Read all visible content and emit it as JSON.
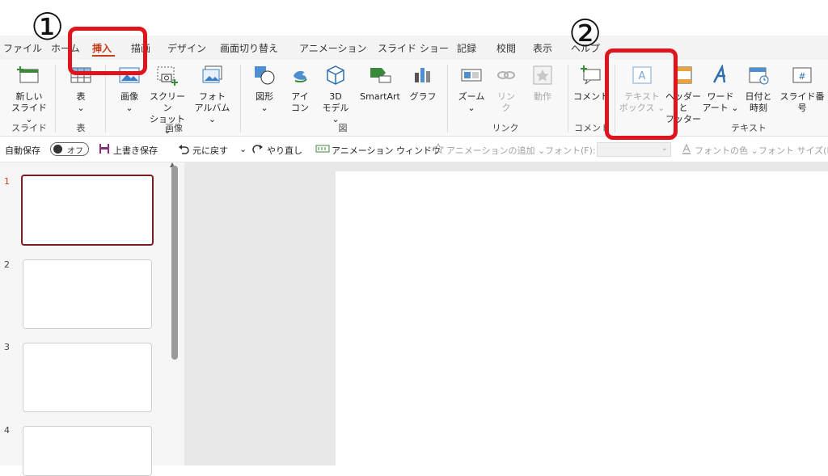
{
  "menu": {
    "tabs": [
      "ファイル",
      "ホーム",
      "挿入",
      "描画",
      "デザイン",
      "画面切り替え",
      "アニメーション",
      "スライド ショー",
      "記録",
      "校閲",
      "表示",
      "ヘルプ"
    ]
  },
  "ribbon": {
    "new_slide": [
      "新しい",
      "スライド ⌄"
    ],
    "table": [
      "表",
      "⌄"
    ],
    "image": [
      "画像",
      "⌄"
    ],
    "screenshot": [
      "スクリーン",
      "ショット ⌄"
    ],
    "photo_album": [
      "フォト",
      "アルバム ⌄"
    ],
    "shape": [
      "図形",
      "⌄"
    ],
    "icon": [
      "アイ",
      "コン"
    ],
    "model3d": [
      "3D",
      "モデル ⌄"
    ],
    "smartart": "SmartArt",
    "graph": "グラフ",
    "zoom": [
      "ズーム",
      "⌄"
    ],
    "link": [
      "リン",
      "ク"
    ],
    "action": "動作",
    "comment": "コメント",
    "textbox": [
      "テキスト",
      "ボックス ⌄"
    ],
    "header_footer": [
      "ヘッダーと",
      "フッター"
    ],
    "wordart": [
      "ワード",
      "アート ⌄"
    ],
    "datetime": [
      "日付と",
      "時刻"
    ],
    "slide_number": "スライド番号",
    "groups": {
      "slides": "スライド",
      "table": "表",
      "images": "画像",
      "illustrations": "図",
      "links": "リンク",
      "comments": "コメント",
      "text": "テキスト"
    }
  },
  "qat": {
    "autosave": "自動保存",
    "autosave_state": "オフ",
    "save": "上書き保存",
    "undo": "元に戻す",
    "undo_caret": "⌄",
    "redo": "やり直し",
    "anim_window": "アニメーション ウィンドウ",
    "anim_add": "アニメーションの追加 ⌄",
    "font_label": "フォント(F):",
    "font_value": "",
    "font_color": "フォントの色 ⌄",
    "font_size": "フォント サイズ(F)"
  },
  "slides": [
    "1",
    "2",
    "3",
    "4"
  ],
  "annotations": {
    "one": "①",
    "two": "②"
  },
  "colors": {
    "accent": "#c43e1c",
    "annotation": "#e0141c",
    "selected_thumb": "#7a1f25"
  }
}
